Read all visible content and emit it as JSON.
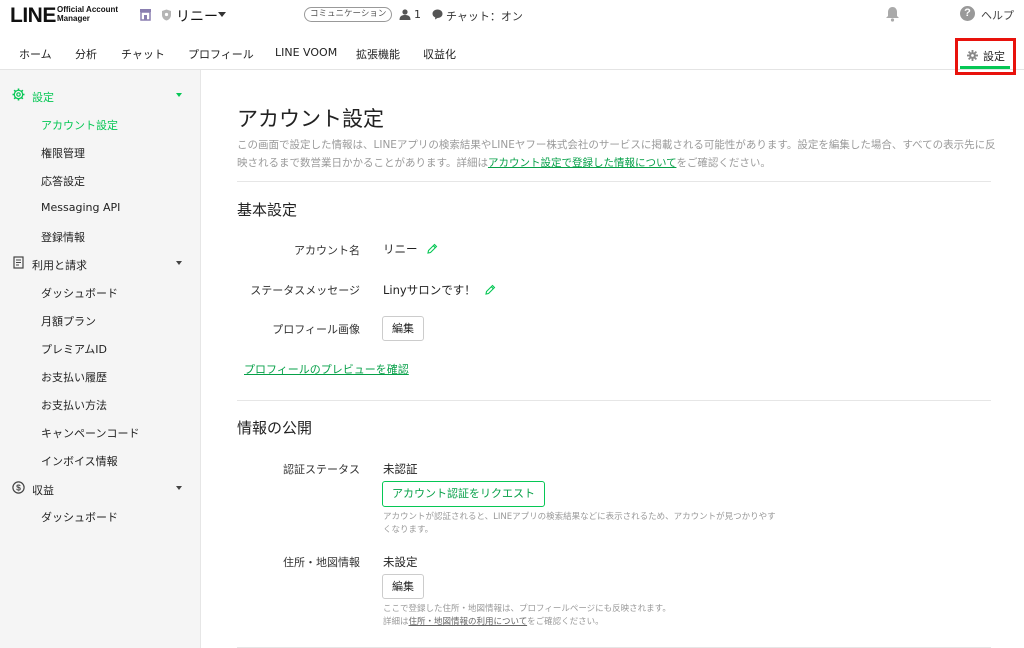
{
  "header": {
    "logo_main": "LINE",
    "logo_sub_line1": "Official Account",
    "logo_sub_line2": "Manager",
    "account_name": "リニー",
    "communication_badge": "コミュニケーション",
    "member_count": "1",
    "chat_status": "チャット：オン",
    "help_label": "ヘルプ",
    "icons": [
      "store-icon",
      "shield-icon",
      "person-icon",
      "chat-bubble-icon",
      "bell-icon",
      "help-icon"
    ]
  },
  "nav": {
    "tabs": [
      "ホーム",
      "分析",
      "チャット",
      "プロフィール",
      "LINE VOOM",
      "拡張機能",
      "収益化"
    ],
    "settings_label": "設定",
    "highlight_color": "#e8120c",
    "accent": "#06c755"
  },
  "sidebar": {
    "groups": [
      {
        "label": "設定",
        "icon": "gear-icon",
        "items": [
          "アカウント設定",
          "権限管理",
          "応答設定",
          "Messaging API",
          "登録情報"
        ]
      },
      {
        "label": "利用と請求",
        "icon": "invoice-icon",
        "items": [
          "ダッシュボード",
          "月額プラン",
          "プレミアムID",
          "お支払い履歴",
          "お支払い方法",
          "キャンペーンコード",
          "インボイス情報"
        ]
      },
      {
        "label": "収益",
        "icon": "dollar-icon",
        "items": [
          "ダッシュボード"
        ]
      }
    ],
    "active_item": "アカウント設定"
  },
  "main": {
    "title": "アカウント設定",
    "description": "この画面で設定した情報は、LINEアプリの検索結果やLINEヤフー株式会社のサービスに掲載される可能性があります。設定を編集した場合、すべての表示先に反映されるまで数営業日かかることがあります。詳細は",
    "description_link": "アカウント設定で登録した情報について",
    "description_end": "をご確認ください。",
    "basic": {
      "title": "基本設定",
      "account_name_label": "アカウント名",
      "account_name_value": "リニー",
      "status_label": "ステータスメッセージ",
      "status_value": "Linyサロンです！",
      "profile_image_label": "プロフィール画像",
      "edit_label": "編集",
      "preview_link": "プロフィールのプレビューを確認"
    },
    "public": {
      "title": "情報の公開",
      "cert_label": "認証ステータス",
      "cert_value": "未認証",
      "cert_button": "アカウント認証をリクエスト",
      "cert_note": "アカウントが認証されると、LINEアプリの検索結果などに表示されるため、アカウントが見つかりやすくなります。",
      "address_label": "住所・地図情報",
      "address_value": "未設定",
      "address_edit": "編集",
      "address_note1": "ここで登録した住所・地図情報は、プロフィールページにも反映されます。",
      "address_note2_pre": "詳細は",
      "address_note2_link": "住所・地図情報の利用について",
      "address_note2_post": "をご確認ください。"
    }
  }
}
